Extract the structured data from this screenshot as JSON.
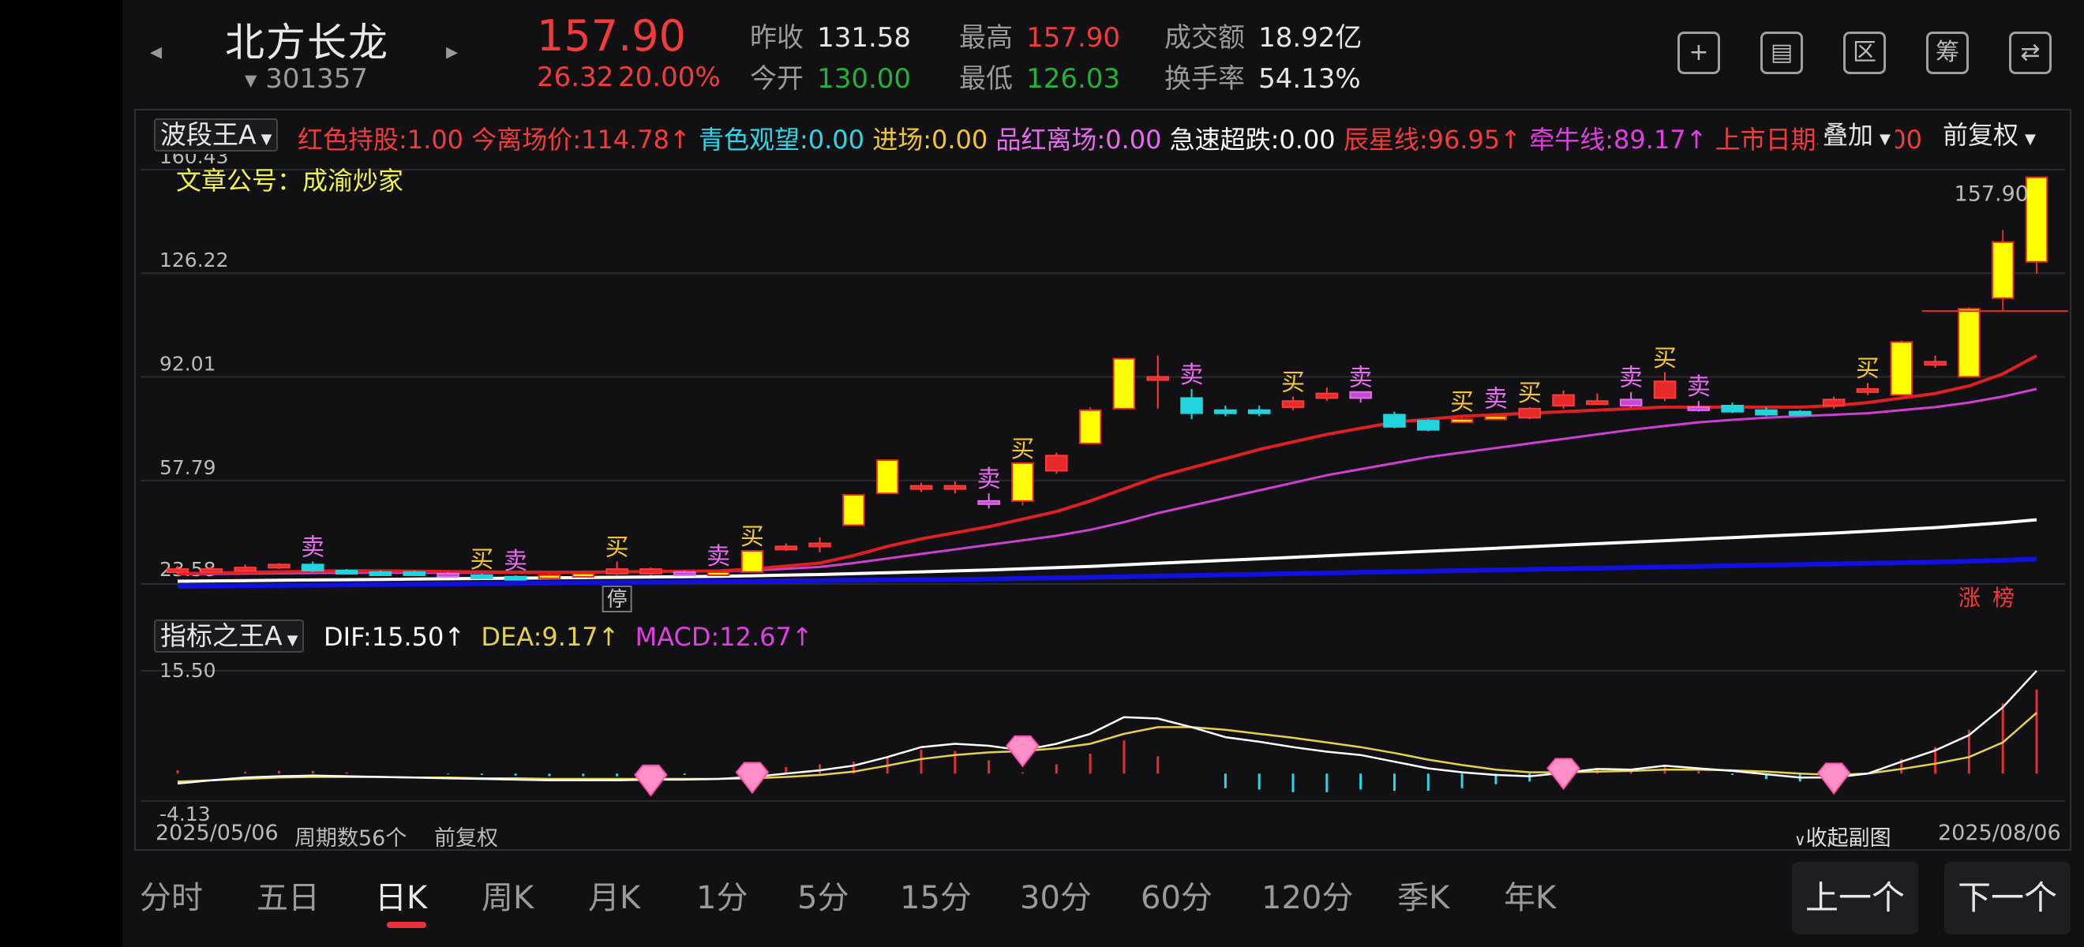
{
  "header": {
    "prev_arrow": "◂",
    "next_arrow": "▸",
    "name": "北方长龙",
    "code": "301357",
    "price": "157.90",
    "change": "26.32",
    "change_pct": "20.00%",
    "quotes": [
      {
        "label": "昨收",
        "value": "131.58",
        "color": "#e6e6e6"
      },
      {
        "label": "今开",
        "value": "130.00",
        "color": "#25b03a"
      },
      {
        "label": "最高",
        "value": "157.90",
        "color": "#f23c3c"
      },
      {
        "label": "最低",
        "value": "126.03",
        "color": "#25b03a"
      },
      {
        "label": "成交额",
        "value": "18.92亿",
        "color": "#e6e6e6"
      },
      {
        "label": "换手率",
        "value": "54.13%",
        "color": "#e6e6e6"
      }
    ],
    "icons": [
      "add-icon",
      "screen-icon",
      "range-icon",
      "calc-icon",
      "device-icon"
    ],
    "icon_glyphs": [
      "+",
      "▤",
      "区",
      "筹",
      "⇄"
    ]
  },
  "main_indicator": {
    "selector": "波段王A",
    "items": [
      {
        "text": "红色持股:1.00",
        "color": "#f23c3c"
      },
      {
        "text": "今离场价:114.78↑",
        "color": "#f23c3c"
      },
      {
        "text": "青色观望:0.00",
        "color": "#2fd6e8"
      },
      {
        "text": "进场:0.00",
        "color": "#f2c531"
      },
      {
        "text": "品红离场:0.00",
        "color": "#e86bf0"
      },
      {
        "text": "急速超跌:0.00",
        "color": "#ffffff"
      },
      {
        "text": "辰星线:96.95↑",
        "color": "#f23c3c"
      },
      {
        "text": "牵牛线:89.17↑",
        "color": "#e040e0"
      },
      {
        "text": "上市日期年:23.00",
        "color": "#f23c3c"
      }
    ],
    "overlay": "叠加",
    "adjust": "前复权",
    "watermark": "文章公号：成渝炒家",
    "y_labels": [
      "160.43",
      "126.22",
      "92.01",
      "57.79",
      "23.58"
    ],
    "last_price": "157.90",
    "stop_label": "停",
    "rank_labels": [
      "涨",
      "榜"
    ]
  },
  "sub_indicator": {
    "selector": "指标之王A",
    "dif": "DIF:15.50↑",
    "dea": "DEA:9.17↑",
    "macd": "MACD:12.67↑",
    "y_top": "15.50",
    "y_bottom": "-4.13"
  },
  "footer": {
    "start_date": "2025/05/06",
    "period": "周期数56个",
    "adjust": "前复权",
    "collapse": "收起副图",
    "end_date": "2025/08/06"
  },
  "tabs": [
    "分时",
    "五日",
    "日K",
    "周K",
    "月K",
    "1分",
    "5分",
    "15分",
    "30分",
    "60分",
    "120分",
    "季K",
    "年K"
  ],
  "active_tab": "日K",
  "prev_button": "上一个",
  "next_button": "下一个",
  "colors": {
    "up": "#f23c3c",
    "down": "#25b03a",
    "ma_red": "#e02020",
    "ma_pink": "#d040d0",
    "ma_white": "#ffffff",
    "ma_blue": "#1010e0",
    "dif": "#ffffff",
    "dea": "#e6d24a",
    "hist_up": "#e03030",
    "hist_down": "#2fd6e8"
  },
  "chart_data": {
    "type": "candlestick",
    "price_axis": [
      23.58,
      57.79,
      92.01,
      126.22,
      160.43
    ],
    "candles": [
      {
        "o": 27.5,
        "c": 28.5,
        "h": 29.5,
        "l": 26.8,
        "k": "r"
      },
      {
        "o": 28.5,
        "c": 28.0,
        "h": 29.5,
        "l": 27.5,
        "k": "r"
      },
      {
        "o": 28.0,
        "c": 29.0,
        "h": 30.0,
        "l": 27.5,
        "k": "r"
      },
      {
        "o": 29.0,
        "c": 30.0,
        "h": 30.5,
        "l": 28.5,
        "k": "r"
      },
      {
        "o": 30.0,
        "c": 28.0,
        "h": 31.0,
        "l": 27.5,
        "k": "c"
      },
      {
        "o": 28.0,
        "c": 27.5,
        "h": 28.5,
        "l": 27.0,
        "k": "c"
      },
      {
        "o": 27.5,
        "c": 27.5,
        "h": 28.0,
        "l": 27.0,
        "k": "c"
      },
      {
        "o": 27.5,
        "c": 27.0,
        "h": 28.0,
        "l": 26.5,
        "k": "c"
      },
      {
        "o": 27.0,
        "c": 26.5,
        "h": 27.5,
        "l": 26.0,
        "k": "m"
      },
      {
        "o": 26.5,
        "c": 26.0,
        "h": 27.0,
        "l": 25.5,
        "k": "c"
      },
      {
        "o": 26.0,
        "c": 26.0,
        "h": 26.5,
        "l": 25.5,
        "k": "c"
      },
      {
        "o": 26.0,
        "c": 26.5,
        "h": 27.0,
        "l": 25.5,
        "k": "y"
      },
      {
        "o": 26.5,
        "c": 27.0,
        "h": 28.0,
        "l": 26.0,
        "k": "y"
      },
      {
        "o": 27.0,
        "c": 28.5,
        "h": 31.0,
        "l": 26.5,
        "k": "r"
      },
      {
        "o": 28.5,
        "c": 27.0,
        "h": 29.0,
        "l": 26.5,
        "k": "r"
      },
      {
        "o": 27.0,
        "c": 27.5,
        "h": 28.0,
        "l": 26.5,
        "k": "m"
      },
      {
        "o": 27.5,
        "c": 27.0,
        "h": 28.0,
        "l": 26.5,
        "k": "y"
      },
      {
        "o": 27.5,
        "c": 34.5,
        "h": 34.5,
        "l": 27.5,
        "k": "y"
      },
      {
        "o": 35.0,
        "c": 36.0,
        "h": 37.0,
        "l": 34.5,
        "k": "r"
      },
      {
        "o": 36.0,
        "c": 37.0,
        "h": 39.0,
        "l": 34.0,
        "k": "r"
      },
      {
        "o": 43.0,
        "c": 53.0,
        "h": 53.0,
        "l": 43.0,
        "k": "y"
      },
      {
        "o": 53.5,
        "c": 64.5,
        "h": 64.5,
        "l": 53.5,
        "k": "y"
      },
      {
        "o": 55.0,
        "c": 56.0,
        "h": 57.0,
        "l": 54.0,
        "k": "r"
      },
      {
        "o": 56.0,
        "c": 55.0,
        "h": 57.5,
        "l": 53.5,
        "k": "r"
      },
      {
        "o": 51.0,
        "c": 50.5,
        "h": 53.5,
        "l": 48.5,
        "k": "m"
      },
      {
        "o": 51.0,
        "c": 63.5,
        "h": 63.5,
        "l": 49.5,
        "k": "y"
      },
      {
        "o": 61.0,
        "c": 66.0,
        "h": 67.0,
        "l": 60.0,
        "k": "r"
      },
      {
        "o": 70.0,
        "c": 81.0,
        "h": 82.0,
        "l": 70.0,
        "k": "y"
      },
      {
        "o": 81.5,
        "c": 98.0,
        "h": 98.0,
        "l": 81.5,
        "k": "y"
      },
      {
        "o": 92.0,
        "c": 91.0,
        "h": 99.0,
        "l": 81.5,
        "k": "r"
      },
      {
        "o": 85.0,
        "c": 80.0,
        "h": 88.0,
        "l": 78.0,
        "k": "c"
      },
      {
        "o": 81.0,
        "c": 80.5,
        "h": 82.5,
        "l": 79.0,
        "k": "c"
      },
      {
        "o": 81.0,
        "c": 80.0,
        "h": 82.5,
        "l": 79.0,
        "k": "c"
      },
      {
        "o": 84.0,
        "c": 82.0,
        "h": 85.5,
        "l": 81.0,
        "k": "r"
      },
      {
        "o": 86.5,
        "c": 85.0,
        "h": 88.5,
        "l": 84.0,
        "k": "r"
      },
      {
        "o": 85.0,
        "c": 87.0,
        "h": 87.0,
        "l": 83.5,
        "k": "m"
      },
      {
        "o": 79.5,
        "c": 75.5,
        "h": 80.5,
        "l": 75.0,
        "k": "c"
      },
      {
        "o": 77.5,
        "c": 74.5,
        "h": 78.0,
        "l": 74.0,
        "k": "c"
      },
      {
        "o": 78.0,
        "c": 78.0,
        "h": 79.0,
        "l": 77.0,
        "k": "y"
      },
      {
        "o": 79.0,
        "c": 79.0,
        "h": 80.0,
        "l": 78.0,
        "k": "y"
      },
      {
        "o": 78.5,
        "c": 81.5,
        "h": 82.0,
        "l": 78.0,
        "k": "r"
      },
      {
        "o": 82.5,
        "c": 86.0,
        "h": 87.5,
        "l": 81.5,
        "k": "r"
      },
      {
        "o": 84.0,
        "c": 84.0,
        "h": 86.5,
        "l": 83.0,
        "k": "r"
      },
      {
        "o": 84.5,
        "c": 82.5,
        "h": 87.0,
        "l": 82.0,
        "k": "m"
      },
      {
        "o": 85.0,
        "c": 90.5,
        "h": 93.5,
        "l": 84.0,
        "k": "r"
      },
      {
        "o": 82.0,
        "c": 81.0,
        "h": 84.0,
        "l": 80.5,
        "k": "m"
      },
      {
        "o": 82.5,
        "c": 80.5,
        "h": 83.5,
        "l": 80.0,
        "k": "c"
      },
      {
        "o": 81.0,
        "c": 79.5,
        "h": 82.0,
        "l": 79.0,
        "k": "c"
      },
      {
        "o": 80.5,
        "c": 79.5,
        "h": 81.0,
        "l": 79.0,
        "k": "c"
      },
      {
        "o": 82.5,
        "c": 84.5,
        "h": 85.5,
        "l": 81.5,
        "k": "r"
      },
      {
        "o": 87.0,
        "c": 88.0,
        "h": 90.0,
        "l": 86.0,
        "k": "r"
      },
      {
        "o": 86.0,
        "c": 103.5,
        "h": 104.0,
        "l": 86.0,
        "k": "y"
      },
      {
        "o": 97.0,
        "c": 96.0,
        "h": 99.0,
        "l": 95.0,
        "k": "r"
      },
      {
        "o": 92.0,
        "c": 114.5,
        "h": 115.0,
        "l": 92.0,
        "k": "y"
      },
      {
        "o": 118.0,
        "c": 136.5,
        "h": 140.5,
        "l": 114.0,
        "k": "y"
      },
      {
        "o": 130.0,
        "c": 157.9,
        "h": 157.9,
        "l": 126.03,
        "k": "y"
      }
    ],
    "marks": [
      {
        "i": 4,
        "t": "卖",
        "c": "#e86bf0"
      },
      {
        "i": 9,
        "t": "买",
        "c": "#f2c531"
      },
      {
        "i": 10,
        "t": "卖",
        "c": "#e86bf0"
      },
      {
        "i": 13,
        "t": "买",
        "c": "#f2c531"
      },
      {
        "i": 16,
        "t": "卖",
        "c": "#e86bf0"
      },
      {
        "i": 17,
        "t": "买",
        "c": "#f2c531"
      },
      {
        "i": 24,
        "t": "卖",
        "c": "#e86bf0"
      },
      {
        "i": 25,
        "t": "买",
        "c": "#f2c531"
      },
      {
        "i": 30,
        "t": "卖",
        "c": "#e86bf0"
      },
      {
        "i": 33,
        "t": "买",
        "c": "#f2c531"
      },
      {
        "i": 35,
        "t": "卖",
        "c": "#e86bf0"
      },
      {
        "i": 38,
        "t": "买",
        "c": "#f2c531"
      },
      {
        "i": 39,
        "t": "卖",
        "c": "#e86bf0"
      },
      {
        "i": 40,
        "t": "买",
        "c": "#f2c531"
      },
      {
        "i": 43,
        "t": "卖",
        "c": "#e86bf0"
      },
      {
        "i": 44,
        "t": "买",
        "c": "#f2c531"
      },
      {
        "i": 45,
        "t": "卖",
        "c": "#e86bf0"
      },
      {
        "i": 50,
        "t": "买",
        "c": "#f2c531"
      }
    ],
    "ma_red": [
      27,
      27.2,
      27.4,
      27.6,
      27.8,
      27.9,
      27.9,
      27.8,
      27.7,
      27.6,
      27.5,
      27.5,
      27.5,
      27.6,
      27.7,
      27.8,
      27.9,
      28.5,
      29.5,
      30.5,
      33,
      36,
      38.5,
      40.5,
      42.5,
      45,
      47.5,
      51,
      55,
      59,
      62,
      65,
      68,
      70.5,
      73,
      75,
      77,
      78,
      79,
      79.5,
      80,
      80.5,
      81,
      81.5,
      82,
      82,
      82,
      82,
      82,
      82.5,
      83.5,
      85,
      86.5,
      89,
      93,
      99
    ],
    "ma_pink": [
      26.8,
      26.9,
      27,
      27.1,
      27.2,
      27.3,
      27.3,
      27.3,
      27.3,
      27.3,
      27.3,
      27.3,
      27.4,
      27.5,
      27.6,
      27.7,
      27.8,
      28.1,
      28.6,
      29.2,
      30.5,
      32,
      33.5,
      35,
      36.5,
      38,
      39.5,
      41.5,
      44,
      47,
      49.5,
      52,
      54.5,
      57,
      59.5,
      61.5,
      63.5,
      65.5,
      67,
      68.5,
      70,
      71.5,
      73,
      74.5,
      75.8,
      77,
      77.8,
      78.5,
      79,
      79.5,
      80,
      81,
      82,
      83.5,
      85.5,
      88
    ],
    "ma_white": [
      24.5,
      24.6,
      24.7,
      24.8,
      24.9,
      25,
      25.1,
      25.2,
      25.3,
      25.4,
      25.5,
      25.6,
      25.7,
      25.8,
      25.9,
      26,
      26.1,
      26.3,
      26.5,
      26.7,
      27,
      27.3,
      27.6,
      27.9,
      28.2,
      28.6,
      29,
      29.4,
      29.9,
      30.4,
      30.9,
      31.4,
      31.9,
      32.4,
      32.9,
      33.4,
      33.9,
      34.4,
      34.9,
      35.4,
      35.9,
      36.4,
      36.9,
      37.4,
      37.9,
      38.4,
      38.9,
      39.4,
      39.9,
      40.4,
      41,
      41.6,
      42.2,
      43,
      43.8,
      44.8
    ],
    "ma_blue": [
      22.8,
      22.9,
      23,
      23.1,
      23.2,
      23.3,
      23.4,
      23.5,
      23.6,
      23.7,
      23.8,
      23.9,
      24,
      24.1,
      24.2,
      24.3,
      24.4,
      24.5,
      24.6,
      24.7,
      24.8,
      24.9,
      25,
      25.1,
      25.2,
      25.4,
      25.6,
      25.8,
      26,
      26.2,
      26.4,
      26.6,
      26.8,
      27,
      27.2,
      27.4,
      27.6,
      27.8,
      28,
      28.2,
      28.4,
      28.6,
      28.8,
      29,
      29.2,
      29.4,
      29.6,
      29.8,
      30,
      30.2,
      30.4,
      30.6,
      30.8,
      31.1,
      31.4,
      31.8
    ],
    "macd_axis": [
      -4.13,
      15.5
    ],
    "dif": [
      -1.5,
      -1,
      -0.6,
      -0.4,
      -0.3,
      -0.4,
      -0.5,
      -0.6,
      -0.7,
      -0.8,
      -0.9,
      -1,
      -1,
      -1,
      -0.9,
      -0.9,
      -0.8,
      -0.5,
      0,
      0.5,
      1.2,
      2.5,
      4,
      4.5,
      4.2,
      3.5,
      4.5,
      6,
      8.5,
      8.3,
      7,
      5.5,
      4.8,
      4,
      3.3,
      2.8,
      1.8,
      0.8,
      0.2,
      -0.2,
      -0.4,
      0.1,
      0.7,
      0.6,
      1.2,
      0.8,
      0.4,
      -0.1,
      -0.6,
      -0.6,
      0,
      1.8,
      3.5,
      5.8,
      10,
      15.5
    ],
    "dea": [
      -1.2,
      -1,
      -0.8,
      -0.6,
      -0.5,
      -0.5,
      -0.5,
      -0.6,
      -0.6,
      -0.7,
      -0.7,
      -0.8,
      -0.8,
      -0.8,
      -0.8,
      -0.8,
      -0.8,
      -0.7,
      -0.5,
      -0.2,
      0.3,
      1.2,
      2.2,
      2.8,
      3.2,
      3.4,
      3.8,
      4.5,
      6,
      7,
      7,
      6.6,
      6,
      5.4,
      4.7,
      4,
      3.1,
      2.1,
      1.3,
      0.6,
      0.2,
      0.2,
      0.3,
      0.4,
      0.6,
      0.6,
      0.5,
      0.3,
      0,
      -0.2,
      0,
      0.7,
      1.5,
      2.5,
      4.7,
      9.17
    ],
    "macd": [
      0.5,
      0,
      0.3,
      0.4,
      0.4,
      0.2,
      0,
      0,
      -0.1,
      -0.2,
      -0.3,
      -0.4,
      -0.4,
      -0.4,
      -0.2,
      -0.2,
      0,
      0.4,
      1,
      1.4,
      1.8,
      2.6,
      3.6,
      3.4,
      2,
      0.2,
      1.4,
      3,
      5,
      2.6,
      0,
      -2.2,
      -2.4,
      -2.8,
      -2.8,
      -2.4,
      -2.6,
      -2.6,
      -2.2,
      -1.6,
      -1.2,
      -0.2,
      0.8,
      0.4,
      1.2,
      0.4,
      -0.2,
      -0.8,
      -1.2,
      -0.8,
      0,
      2.2,
      4,
      6.6,
      10.6,
      12.67
    ],
    "gem_indices": [
      14,
      17,
      25,
      41,
      49
    ]
  }
}
